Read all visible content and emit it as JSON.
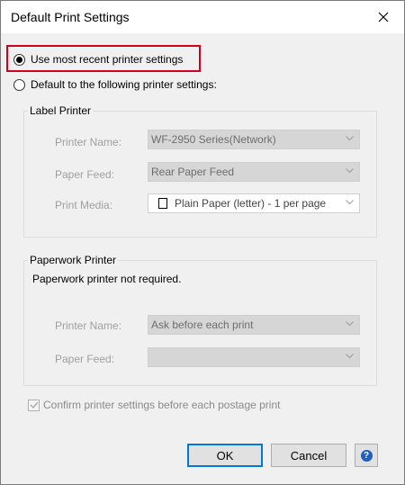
{
  "window": {
    "title": "Default Print Settings"
  },
  "options": {
    "recent_label": "Use most recent printer settings",
    "default_label": "Default to the following printer settings:",
    "selected": "recent"
  },
  "label_printer": {
    "group_title": "Label Printer",
    "printer_name_label": "Printer Name:",
    "printer_name_value": "WF-2950 Series(Network)",
    "paper_feed_label": "Paper Feed:",
    "paper_feed_value": "Rear Paper Feed",
    "print_media_label": "Print Media:",
    "print_media_value": "Plain Paper (letter) - 1 per page"
  },
  "paperwork_printer": {
    "group_title": "Paperwork Printer",
    "note": "Paperwork printer not required.",
    "printer_name_label": "Printer Name:",
    "printer_name_value": "Ask before each print",
    "paper_feed_label": "Paper Feed:",
    "paper_feed_value": ""
  },
  "confirm": {
    "label": "Confirm printer settings before each postage print",
    "checked": true
  },
  "buttons": {
    "ok": "OK",
    "cancel": "Cancel",
    "help": "?"
  },
  "colors": {
    "highlight": "#d0021b",
    "primary_border": "#0078d7",
    "help_blue": "#1f5fbf"
  }
}
